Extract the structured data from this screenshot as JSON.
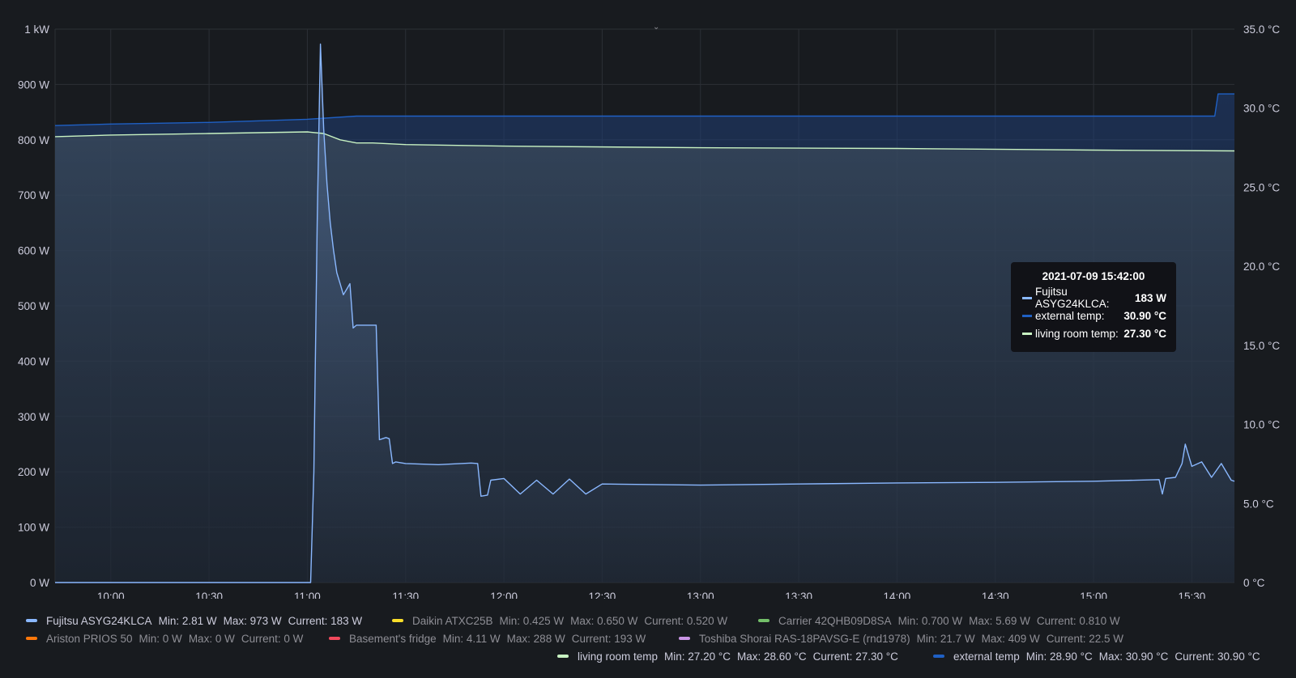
{
  "chart_data": {
    "type": "line",
    "x_ticks": [
      "10:00",
      "10:30",
      "11:00",
      "11:30",
      "12:00",
      "12:30",
      "13:00",
      "13:30",
      "14:00",
      "14:30",
      "15:00",
      "15:30"
    ],
    "x_range": [
      "09:43",
      "15:43"
    ],
    "y_left": {
      "ticks": [
        "0 W",
        "100 W",
        "200 W",
        "300 W",
        "400 W",
        "500 W",
        "600 W",
        "700 W",
        "800 W",
        "900 W",
        "1 kW"
      ],
      "range": [
        0,
        1000
      ]
    },
    "y_right": {
      "ticks": [
        "0 °C",
        "5.0 °C",
        "10.0 °C",
        "15.0 °C",
        "20.0 °C",
        "25.0 °C",
        "30.0 °C",
        "35.0 °C"
      ],
      "range": [
        0,
        35
      ]
    },
    "grid": true,
    "series": [
      {
        "name": "Fujitsu ASYG24KLCA",
        "axis": "left",
        "color": "#8ab8ff",
        "fill": true,
        "x": [
          "09:43",
          "10:00",
          "10:30",
          "11:00",
          "11:01",
          "11:02",
          "11:03",
          "11:04",
          "11:05",
          "11:06",
          "11:07",
          "11:08",
          "11:09",
          "11:10",
          "11:11",
          "11:12",
          "11:13",
          "11:14",
          "11:15",
          "11:16",
          "11:17",
          "11:18",
          "11:19",
          "11:20",
          "11:21",
          "11:22",
          "11:23",
          "11:24",
          "11:25",
          "11:26",
          "11:27",
          "11:30",
          "11:40",
          "11:50",
          "11:52",
          "11:53",
          "11:55",
          "11:56",
          "12:00",
          "12:05",
          "12:10",
          "12:15",
          "12:20",
          "12:25",
          "12:30",
          "13:00",
          "13:30",
          "14:00",
          "14:30",
          "15:00",
          "15:20",
          "15:21",
          "15:22",
          "15:25",
          "15:27",
          "15:28",
          "15:30",
          "15:33",
          "15:36",
          "15:39",
          "15:42",
          "15:43"
        ],
        "y": [
          0,
          0,
          0,
          0,
          0,
          200,
          650,
          973,
          820,
          720,
          650,
          600,
          560,
          540,
          520,
          530,
          540,
          460,
          465,
          465,
          465,
          465,
          465,
          465,
          465,
          258,
          260,
          262,
          260,
          215,
          218,
          215,
          213,
          216,
          215,
          156,
          158,
          185,
          188,
          160,
          185,
          160,
          187,
          160,
          178,
          176,
          178,
          180,
          181,
          183,
          186,
          160,
          188,
          190,
          215,
          250,
          210,
          218,
          190,
          215,
          185,
          183
        ]
      },
      {
        "name": "external temp",
        "axis": "right",
        "color": "#1f60c4",
        "fill": true,
        "x": [
          "09:43",
          "10:00",
          "10:30",
          "11:00",
          "11:15",
          "12:00",
          "13:00",
          "14:00",
          "15:00",
          "15:37",
          "15:38",
          "15:43"
        ],
        "y": [
          28.9,
          29.0,
          29.1,
          29.3,
          29.5,
          29.5,
          29.5,
          29.5,
          29.5,
          29.5,
          30.9,
          30.9
        ]
      },
      {
        "name": "living room temp",
        "axis": "right",
        "color": "#c8f2c2",
        "fill": true,
        "x": [
          "09:43",
          "10:00",
          "10:30",
          "11:00",
          "11:05",
          "11:10",
          "11:15",
          "11:20",
          "11:30",
          "12:00",
          "13:00",
          "14:00",
          "15:00",
          "15:43"
        ],
        "y": [
          28.2,
          28.3,
          28.4,
          28.5,
          28.4,
          28.0,
          27.8,
          27.8,
          27.7,
          27.6,
          27.5,
          27.45,
          27.35,
          27.3
        ]
      }
    ]
  },
  "tooltip": {
    "time": "2021-07-09 15:42:00",
    "rows": [
      {
        "label": "Fujitsu ASYG24KLCA:",
        "value": "183 W",
        "color": "#8ab8ff"
      },
      {
        "label": "external temp:",
        "value": "30.90 °C",
        "color": "#1f60c4"
      },
      {
        "label": "living room temp:",
        "value": "27.30 °C",
        "color": "#c8f2c2"
      }
    ]
  },
  "legend": {
    "rows": [
      [
        {
          "name": "Fujitsu ASYG24KLCA",
          "stats": [
            "Min: 2.81 W",
            "Max: 973 W",
            "Current: 183 W"
          ],
          "color": "#8ab8ff",
          "dim": false
        },
        {
          "name": "Daikin ATXC25B",
          "stats": [
            "Min: 0.425 W",
            "Max: 0.650 W",
            "Current: 0.520 W"
          ],
          "color": "#fade2a",
          "dim": true
        },
        {
          "name": "Carrier 42QHB09D8SA",
          "stats": [
            "Min: 0.700 W",
            "Max: 5.69 W",
            "Current: 0.810 W"
          ],
          "color": "#73bf69",
          "dim": true
        }
      ],
      [
        {
          "name": "Ariston PRIOS 50",
          "stats": [
            "Min: 0 W",
            "Max: 0 W",
            "Current: 0 W"
          ],
          "color": "#ff780a",
          "dim": true
        },
        {
          "name": "Basement's fridge",
          "stats": [
            "Min: 4.11 W",
            "Max: 288 W",
            "Current: 193 W"
          ],
          "color": "#f2495c",
          "dim": true
        },
        {
          "name": "Toshiba Shorai RAS-18PAVSG-E (rnd1978)",
          "stats": [
            "Min: 21.7 W",
            "Max: 409 W",
            "Current: 22.5 W"
          ],
          "color": "#ca95e5",
          "dim": true
        }
      ],
      [
        {
          "name": "living room temp",
          "stats": [
            "Min: 27.20 °C",
            "Max: 28.60 °C",
            "Current: 27.30 °C"
          ],
          "color": "#c8f2c2",
          "dim": false
        },
        {
          "name": "external temp",
          "stats": [
            "Min: 28.90 °C",
            "Max: 30.90 °C",
            "Current: 30.90 °C"
          ],
          "color": "#1f60c4",
          "dim": false
        }
      ]
    ]
  }
}
